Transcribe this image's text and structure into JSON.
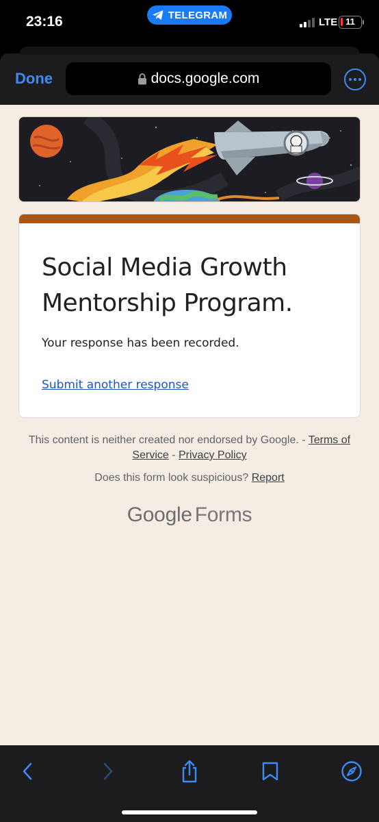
{
  "status_bar": {
    "time": "23:16",
    "app_pill": "TELEGRAM",
    "network": "LTE",
    "battery": "11",
    "battery_level": 0.11
  },
  "browser": {
    "done_label": "Done",
    "url": "docs.google.com"
  },
  "form": {
    "title": "Social Media Growth Mentorship Program.",
    "response_message": "Your response has been recorded.",
    "submit_another": "Submit another response"
  },
  "footer": {
    "disclaimer_text": "This content is neither created nor endorsed by Google. - ",
    "terms_link": "Terms of Service",
    "separator": " - ",
    "privacy_link": "Privacy Policy",
    "suspicious_text": "Does this form look suspicious? ",
    "report_link": "Report",
    "brand_google": "Google",
    "brand_forms": "Forms"
  },
  "icons": {
    "back": "chevron-left-icon",
    "forward": "chevron-right-icon",
    "share": "share-icon",
    "bookmarks": "book-icon",
    "open_in_browser": "compass-icon"
  },
  "colors": {
    "accent": "#a85614",
    "link": "#1a56c8",
    "ios_blue": "#3d8cf5",
    "telegram": "#1a7cf5",
    "page_bg": "#f5ece3"
  }
}
